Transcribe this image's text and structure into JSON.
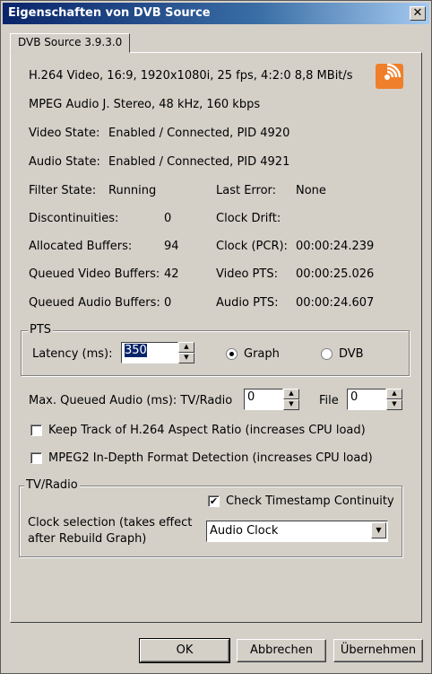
{
  "window": {
    "title": "Eigenschaften von DVB Source",
    "close_glyph": "✕"
  },
  "tab": {
    "label": "DVB Source 3.9.3.0"
  },
  "info": {
    "video_line": "H.264 Video, 16:9, 1920x1080i, 25 fps, 4:2:0   8,8 MBit/s",
    "audio_line": "MPEG Audio J. Stereo, 48 kHz, 160 kbps",
    "video_state_label": "Video State:",
    "video_state_value": "Enabled / Connected, PID 4920",
    "audio_state_label": "Audio State:",
    "audio_state_value": "Enabled / Connected, PID 4921",
    "filter_state_label": "Filter State:",
    "filter_state_value": "Running",
    "last_error_label": "Last Error:",
    "last_error_value": "None",
    "discont_label": "Discontinuities:",
    "discont_value": "0",
    "clock_drift_label": "Clock Drift:",
    "alloc_label": "Allocated Buffers:",
    "alloc_value": "94",
    "clock_pcr_label": "Clock (PCR):",
    "clock_pcr_value": "00:00:24.239",
    "qvideo_label": "Queued Video Buffers:",
    "qvideo_value": "42",
    "video_pts_label": "Video PTS:",
    "video_pts_value": "00:00:25.026",
    "qaudio_label": "Queued Audio Buffers:",
    "qaudio_value": "0",
    "audio_pts_label": "Audio PTS:",
    "audio_pts_value": "00:00:24.607"
  },
  "pts": {
    "legend": "PTS",
    "latency_label": "Latency (ms):",
    "latency_value": "350",
    "graph_label": "Graph",
    "dvb_label": "DVB",
    "selected": "Graph"
  },
  "maxq": {
    "label": "Max. Queued Audio (ms): TV/Radio",
    "tvradio_value": "0",
    "file_label": "File",
    "file_value": "0"
  },
  "options": {
    "keep_track_label": "Keep Track of H.264 Aspect Ratio (increases CPU load)",
    "keep_track_checked": false,
    "mpeg2_label": "MPEG2 In-Depth Format Detection (increases CPU load)",
    "mpeg2_checked": false
  },
  "tvradio": {
    "legend": "TV/Radio",
    "check_ts_label": "Check Timestamp Continuity",
    "check_ts_checked": true,
    "clock_sel_line1": "Clock selection (takes effect",
    "clock_sel_line2": "after Rebuild Graph)",
    "clock_value": "Audio Clock"
  },
  "buttons": {
    "ok": "OK",
    "cancel": "Abbrechen",
    "apply": "Übernehmen"
  },
  "colors": {
    "rss_orange": "#ef7f2a",
    "title_blue": "#0a246a"
  }
}
